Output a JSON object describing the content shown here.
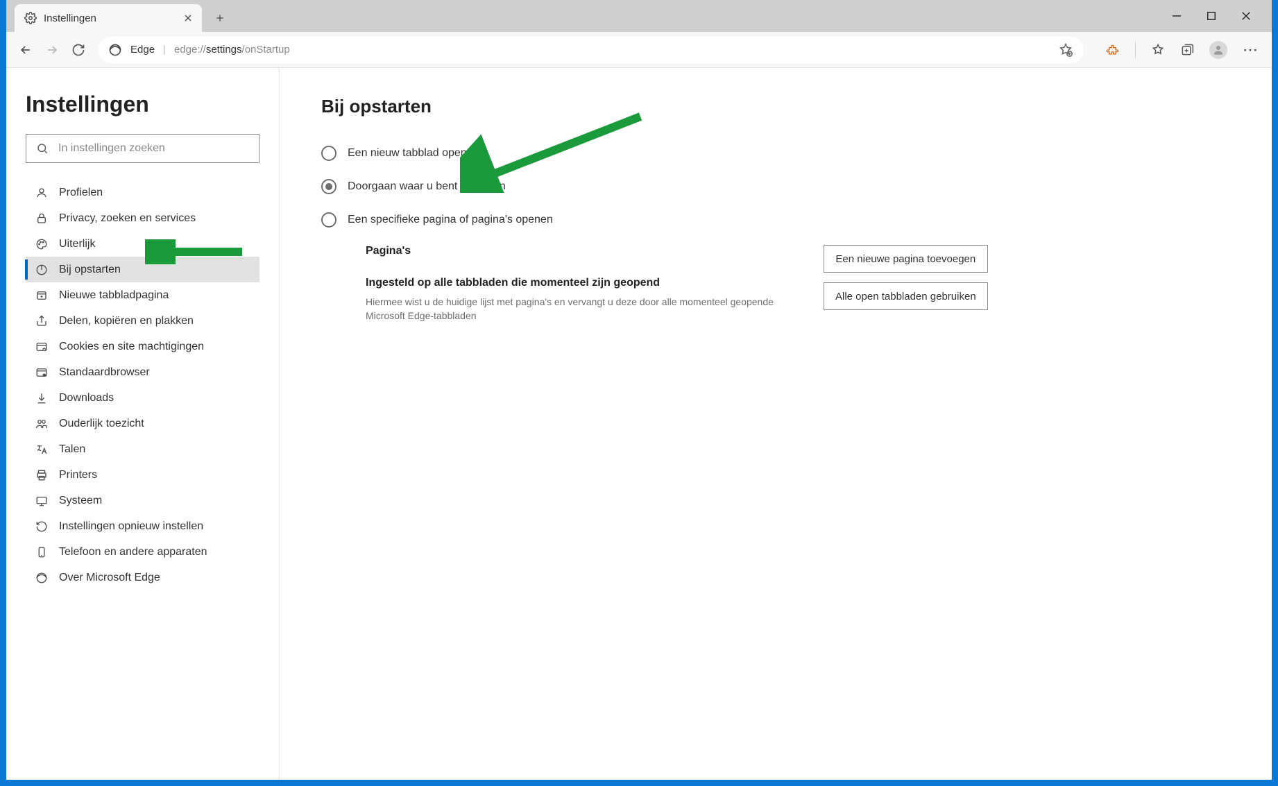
{
  "window": {
    "tab_title": "Instellingen",
    "address_host": "Edge",
    "address_segments": [
      "edge://",
      "settings",
      "/onStartup"
    ]
  },
  "sidebar": {
    "title": "Instellingen",
    "search_placeholder": "In instellingen zoeken",
    "items": [
      {
        "icon": "user-icon",
        "label": "Profielen"
      },
      {
        "icon": "lock-icon",
        "label": "Privacy, zoeken en services"
      },
      {
        "icon": "palette-icon",
        "label": "Uiterlijk"
      },
      {
        "icon": "power-icon",
        "label": "Bij opstarten",
        "active": true
      },
      {
        "icon": "newtab-icon",
        "label": "Nieuwe tabbladpagina"
      },
      {
        "icon": "share-icon",
        "label": "Delen, kopiëren en plakken"
      },
      {
        "icon": "cookies-icon",
        "label": "Cookies en site machtigingen"
      },
      {
        "icon": "default-icon",
        "label": "Standaardbrowser"
      },
      {
        "icon": "download-icon",
        "label": "Downloads"
      },
      {
        "icon": "family-icon",
        "label": "Ouderlijk toezicht"
      },
      {
        "icon": "language-icon",
        "label": "Talen"
      },
      {
        "icon": "printer-icon",
        "label": "Printers"
      },
      {
        "icon": "system-icon",
        "label": "Systeem"
      },
      {
        "icon": "reset-icon",
        "label": "Instellingen opnieuw instellen"
      },
      {
        "icon": "phone-icon",
        "label": "Telefoon en andere apparaten"
      },
      {
        "icon": "about-icon",
        "label": "Over Microsoft Edge"
      }
    ]
  },
  "main": {
    "title": "Bij opstarten",
    "options": [
      {
        "label": "Een nieuw tabblad openen",
        "selected": false
      },
      {
        "label": "Doorgaan waar u bent gebleven",
        "selected": true
      },
      {
        "label": "Een specifieke pagina of pagina's openen",
        "selected": false
      }
    ],
    "pages_heading": "Pagina's",
    "set_tabs_heading": "Ingesteld op alle tabbladen die momenteel zijn geopend",
    "set_tabs_desc": "Hiermee wist u de huidige lijst met pagina's en vervangt u deze door alle momenteel geopende Microsoft Edge-tabbladen",
    "btn_add_page": "Een nieuwe pagina toevoegen",
    "btn_use_open": "Alle open tabbladen gebruiken"
  }
}
